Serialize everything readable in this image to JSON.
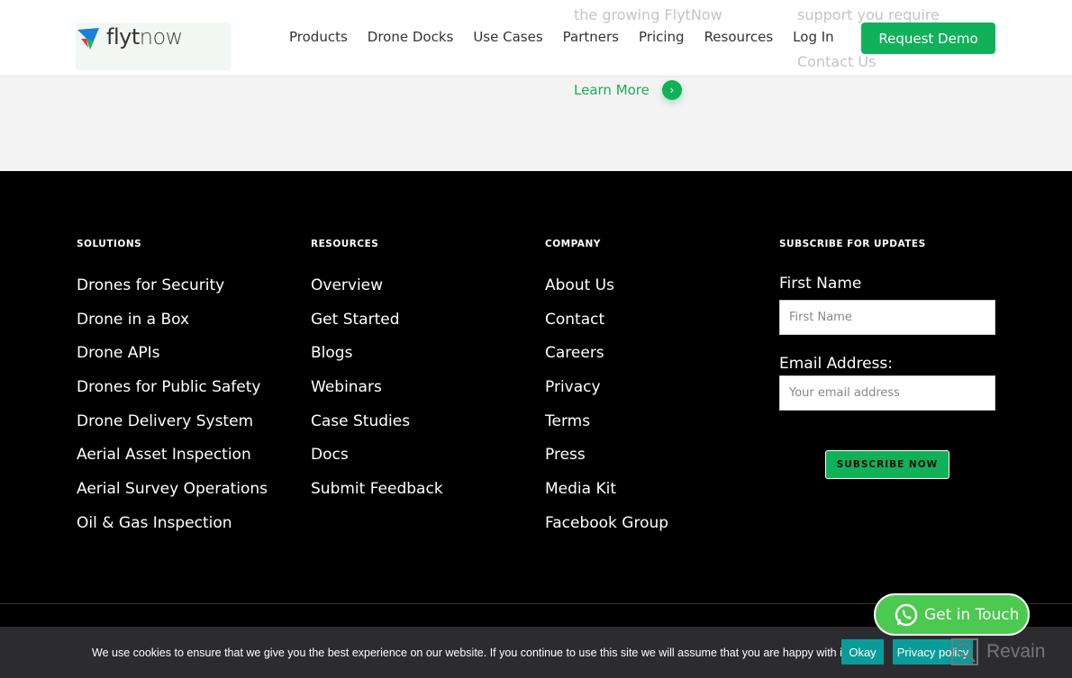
{
  "background": {
    "text_a": "the growing FlytNow",
    "text_b": "support you require",
    "contact": "Contact Us",
    "learn_more": "Learn More"
  },
  "header": {
    "logo_a": "flyt",
    "logo_b": "now",
    "nav": [
      "Products",
      "Drone Docks",
      "Use Cases",
      "Partners",
      "Pricing",
      "Resources",
      "Log In"
    ],
    "cta": "Request Demo"
  },
  "footer": {
    "solutions": {
      "title": "SOLUTIONS",
      "items": [
        "Drones for Security",
        "Drone in a Box",
        "Drone APIs",
        "Drones for Public Safety",
        "Drone Delivery System",
        "Aerial Asset Inspection",
        "Aerial Survey Operations",
        "Oil & Gas Inspection"
      ]
    },
    "resources": {
      "title": "RESOURCES",
      "items": [
        "Overview",
        "Get Started",
        "Blogs",
        "Webinars",
        "Case Studies",
        "Docs",
        "Submit Feedback"
      ]
    },
    "company": {
      "title": "COMPANY",
      "items": [
        "About Us",
        "Contact",
        "Careers",
        "Privacy",
        "Terms",
        "Press",
        "Media Kit",
        "Facebook Group"
      ]
    },
    "subscribe": {
      "title": "SUBSCRIBE FOR UPDATES",
      "first_name_label": "First Name",
      "first_name_placeholder": "First Name",
      "email_label": "Email Address:",
      "email_placeholder": "Your email address",
      "button": "SUBSCRIBE NOW"
    }
  },
  "cookie": {
    "message": "We use cookies to ensure that we give you the best experience on our website. If you continue to use this site we will assume that you are happy with it.",
    "okay": "Okay",
    "privacy": "Privacy policy"
  },
  "whatsapp": {
    "label": "Get in Touch"
  },
  "watermark": "Revain",
  "colors": {
    "accent": "#10b159",
    "cookie_button": "#0a9c9a",
    "whatsapp": "#4cc94f"
  }
}
